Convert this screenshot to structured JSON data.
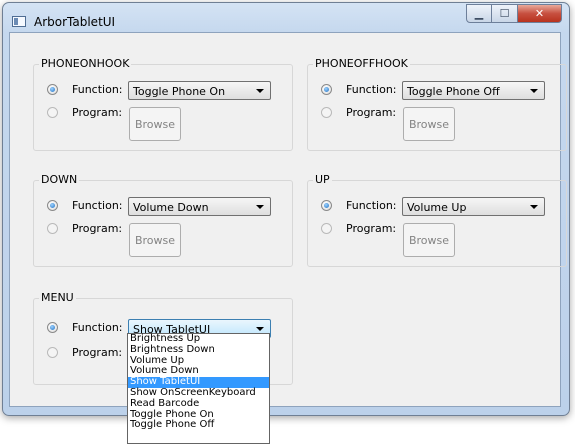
{
  "window": {
    "title": "ArborTabletUI",
    "buttons": {
      "minimize": "▁",
      "maximize": "☐",
      "close": "✕"
    }
  },
  "labels": {
    "function": "Function:",
    "program": "Program:",
    "browse": "Browse"
  },
  "groups": [
    {
      "title": "PHONEONHOOK",
      "function_value": "Toggle Phone On",
      "function_checked": true
    },
    {
      "title": "PHONEOFFHOOK",
      "function_value": "Toggle Phone Off",
      "function_checked": true
    },
    {
      "title": "DOWN",
      "function_value": "Volume Down",
      "function_checked": true
    },
    {
      "title": "UP",
      "function_value": "Volume Up",
      "function_checked": true
    },
    {
      "title": "MENU",
      "function_value": "Show TabletUI",
      "function_checked": true
    }
  ],
  "dropdown": {
    "selected": "Show TabletUI",
    "options": [
      "Brightness Up",
      "Brightness Down",
      "Volume Up",
      "Volume Down",
      "Show TabletUI",
      "Show OnScreenKeyboard",
      "Read Barcode",
      "Toggle Phone On",
      "Toggle Phone Off"
    ]
  },
  "colors": {
    "selection": "#3399ff",
    "close_button": "#c75040"
  }
}
